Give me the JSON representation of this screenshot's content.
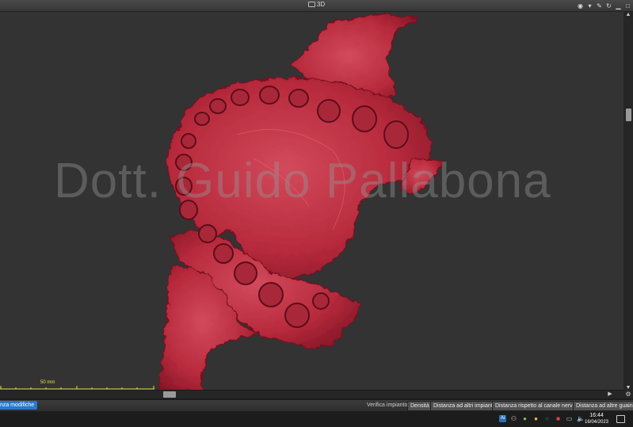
{
  "window": {
    "title": "3D"
  },
  "watermark": "Dott. Guido Pallabona",
  "ruler": {
    "label": "50 mm",
    "color": "#e6e23a"
  },
  "statusbar": {
    "left_button": "nza modifiche",
    "verifica_label": "Verifica impianto:",
    "buttons": [
      "Densità",
      "Distanza ad altri impianti",
      "Distanza rispetto al canale nervo",
      "Distanza ad altre guaine"
    ]
  },
  "taskbar": {
    "time": "16:44",
    "date": "16/04/2023",
    "tray_icons": [
      "ai-icon",
      "app-icon",
      "app-icon",
      "app-icon",
      "app-icon",
      "app-icon",
      "monitor-icon",
      "speaker-icon"
    ]
  },
  "colors": {
    "model": "#b72a3c",
    "viewport": "#333333",
    "accent": "#2c77c8"
  }
}
